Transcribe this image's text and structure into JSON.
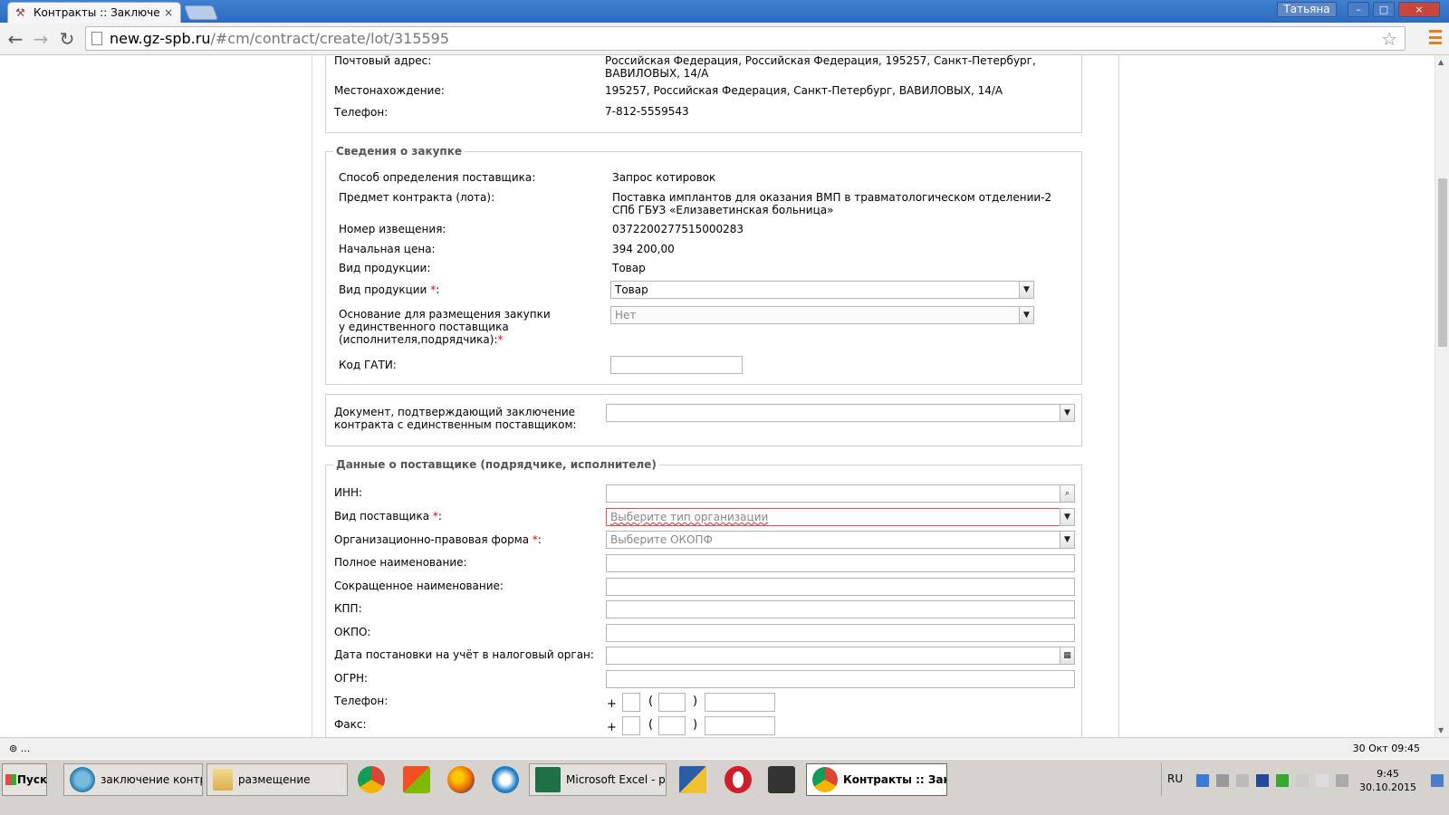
{
  "browser": {
    "tab_title": "Контракты :: Заключение",
    "tab_close": "×",
    "user_name": "Татьяна",
    "win_min": "–",
    "win_max": "□",
    "win_close": "×",
    "url_host": "new.gz-spb.ru",
    "url_path": "/#cm/contract/create/lot/315595"
  },
  "customer": {
    "postal_label": "Почтовый адрес:",
    "postal_value": "Российская Федерация, Российская Федерация, 195257, Санкт-Петербург, ВАВИЛОВЫХ, 14/А",
    "location_label": "Местонахождение:",
    "location_value": "195257, Российская Федерация, Санкт-Петербург, ВАВИЛОВЫХ, 14/А",
    "phone_label": "Телефон:",
    "phone_value": "7-812-5559543"
  },
  "purchase": {
    "legend": "Сведения о закупке",
    "method_label": "Способ определения поставщика:",
    "method_value": "Запрос котировок",
    "subject_label": "Предмет контракта (лота):",
    "subject_value": "Поставка имплантов для оказания ВМП в травматологическом отделении-2 СПб ГБУЗ «Елизаветинская больница»",
    "notice_label": "Номер извещения:",
    "notice_value": "0372200277515000283",
    "price_label": "Начальная цена:",
    "price_value": "394 200,00",
    "product_type_label": "Вид продукции:",
    "product_type_value": "Товар",
    "product_type_select_label": "Вид продукции",
    "product_type_select_value": "Товар",
    "basis_label": "Основание для размещения закупки у единственного поставщика (исполнителя,подрядчика):",
    "basis_value": "Нет",
    "gati_label": "Код ГАТИ:",
    "required_mark": "*"
  },
  "document": {
    "label": "Документ, подтверждающий заключение контракта с единственным поставщиком:",
    "value": ""
  },
  "supplier": {
    "legend": "Данные о поставщике (подрядчике, исполнителе)",
    "inn_label": "ИНН:",
    "type_label": "Вид поставщика",
    "type_placeholder": "Выберите тип организации",
    "okopf_label": "Организационно-правовая форма",
    "okopf_placeholder": "Выберите ОКОПФ",
    "full_name_label": "Полное наименование:",
    "short_name_label": "Сокращенное наименование:",
    "kpp_label": "КПП:",
    "okpo_label": "ОКПО:",
    "tax_date_label": "Дата постановки на учёт в налоговый орган:",
    "ogrn_label": "ОГРН:",
    "phone_label": "Телефон:",
    "fax_label": "Факс:",
    "plus": "+",
    "open_paren": "(",
    "close_paren": ")",
    "colon": ":"
  },
  "statusbar": {
    "left": "⊚ ...",
    "right": "30 Окт 09:45"
  },
  "taskbar": {
    "start": "Пуск",
    "items": [
      {
        "label": "заключение контра..."
      },
      {
        "label": "размещение"
      },
      {
        "label": "Microsoft Excel - рее..."
      },
      {
        "label": "Контракты :: Закл..."
      }
    ],
    "lang": "RU",
    "time": "9:45",
    "date": "30.10.2015"
  }
}
